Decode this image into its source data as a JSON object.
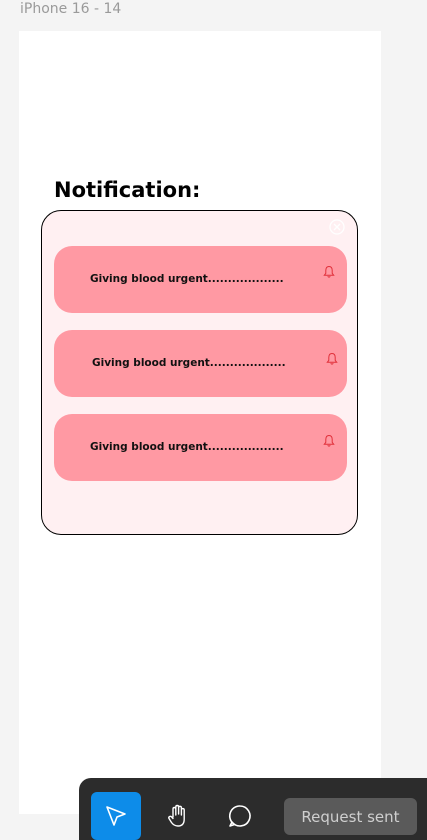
{
  "frame": {
    "label": "iPhone 16 - 14"
  },
  "screen": {
    "title": "Notification:",
    "notifications": [
      {
        "text": "Giving blood urgent..................."
      },
      {
        "text": "Giving blood urgent..................."
      },
      {
        "text": "Giving blood urgent..................."
      }
    ]
  },
  "toolbar": {
    "tools": [
      {
        "icon": "pointer-icon",
        "active": true
      },
      {
        "icon": "hand-icon",
        "active": false
      },
      {
        "icon": "comment-icon",
        "active": false
      }
    ],
    "request_label": "Request sent"
  },
  "colors": {
    "panel_bg": "#fff0f2",
    "card_bg": "#ff99a3",
    "bell": "#e0303a",
    "accent": "#0d8ce9"
  }
}
